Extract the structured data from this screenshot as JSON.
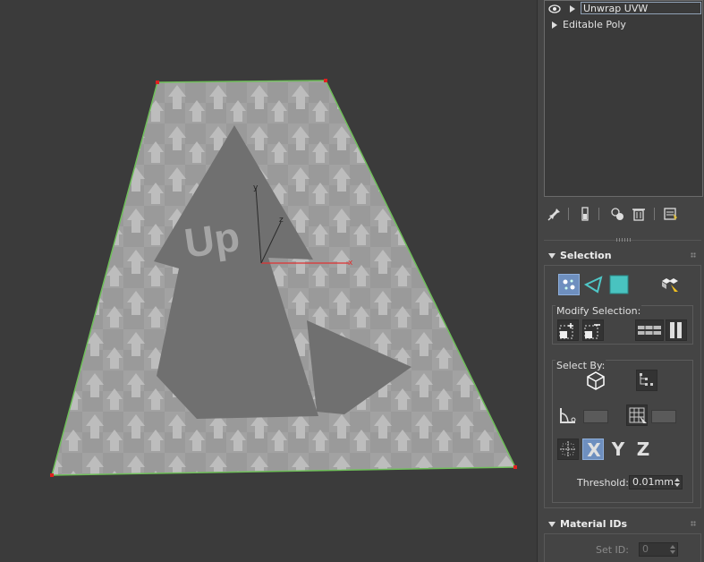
{
  "modifier_stack": {
    "items": [
      {
        "label": "Unwrap UVW",
        "selected": true
      },
      {
        "label": "Editable Poly",
        "selected": false
      }
    ]
  },
  "viewport": {
    "axis_labels": {
      "x": "x",
      "y": "y",
      "z": "z"
    },
    "texture_text": "Up",
    "colors": {
      "background": "#3b3b3b",
      "plane": "#9d9d9d",
      "edge": "#6fbf5a",
      "vertex": "#e02020",
      "x_axis": "#e03030"
    }
  },
  "toolbar": {
    "icons": [
      "pin-icon",
      "show-end-result-icon",
      "make-unique-icon",
      "remove-modifier-icon",
      "configure-modifier-sets-icon"
    ]
  },
  "selection_rollout": {
    "title": "Selection",
    "modify_selection_label": "Modify Selection:",
    "select_by_label": "Select By:",
    "axis_buttons": {
      "x": "X",
      "y": "Y",
      "z": "Z"
    },
    "threshold_label": "Threshold:",
    "threshold_value": "0.01mm"
  },
  "material_ids_rollout": {
    "title": "Material IDs",
    "set_id_label": "Set ID:",
    "set_id_value": "0"
  }
}
